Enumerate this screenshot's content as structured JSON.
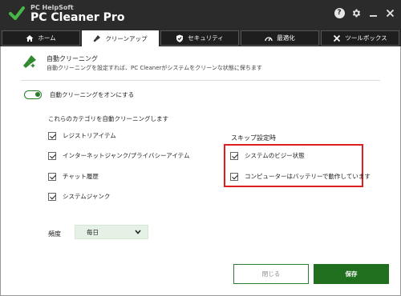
{
  "app": {
    "brand_top": "PC HelpSoft",
    "brand_main": "PC Cleaner Pro"
  },
  "window_controls": [
    {
      "name": "help-icon"
    },
    {
      "name": "gear-icon"
    },
    {
      "name": "minimize-icon"
    },
    {
      "name": "close-icon"
    }
  ],
  "tabs": [
    {
      "label": "ホーム",
      "icon": "home-icon"
    },
    {
      "label": "クリーンアップ",
      "icon": "broom-icon",
      "active": true
    },
    {
      "label": "セキュリティ",
      "icon": "shield-icon"
    },
    {
      "label": "最適化",
      "icon": "speedometer-icon"
    },
    {
      "label": "ツールボックス",
      "icon": "tools-icon"
    }
  ],
  "section": {
    "title": "自動クリーニング",
    "description": "自動クリーニングを設定すれば、PC Cleanerがシステムをクリーンな状態に保ちます"
  },
  "auto_toggle": {
    "label": "自動クリーニングをオンにする",
    "on": true
  },
  "categories": {
    "label": "これらのカテゴリを自動クリーニングします",
    "items": [
      {
        "label": "レジストリアイテム",
        "checked": true
      },
      {
        "label": "インターネットジャンク/プライバシーアイテム",
        "checked": true
      },
      {
        "label": "チャット履歴",
        "checked": true
      },
      {
        "label": "システムジャンク",
        "checked": true
      }
    ]
  },
  "skip": {
    "title": "スキップ設定時",
    "items": [
      {
        "label": "システムのビジー状態",
        "checked": true
      },
      {
        "label": "コンピューターはバッテリーで動作しています",
        "checked": true
      }
    ],
    "highlight_color": "#dd1f1f"
  },
  "frequency": {
    "label": "頻度",
    "value": "毎日"
  },
  "buttons": {
    "close": "閉じる",
    "save": "保存"
  },
  "colors": {
    "accent": "#1f6f1f",
    "titlebar": "#2b2b2b"
  }
}
